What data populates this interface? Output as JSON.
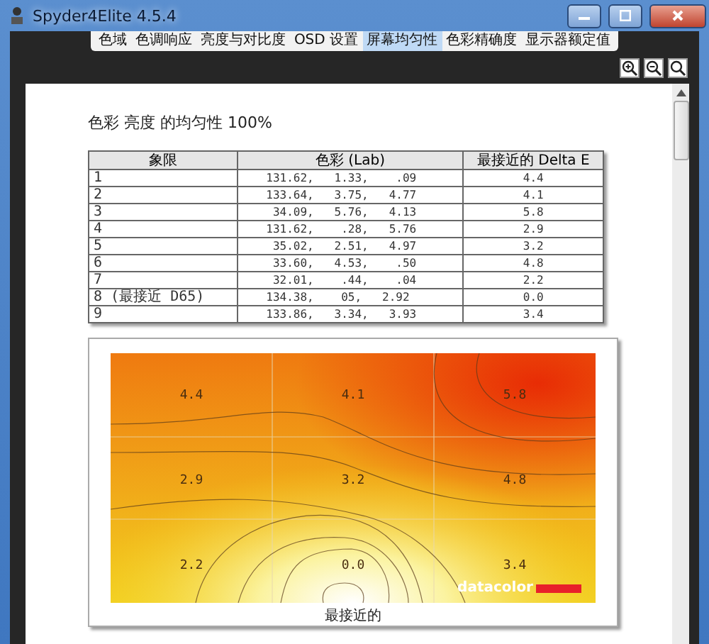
{
  "window": {
    "title": "Spyder4Elite 4.5.4"
  },
  "tabs": [
    {
      "label": "色域",
      "selected": false
    },
    {
      "label": "色调响应",
      "selected": false
    },
    {
      "label": "亮度与对比度",
      "selected": false
    },
    {
      "label": "OSD 设置",
      "selected": false
    },
    {
      "label": "屏幕均匀性",
      "selected": true
    },
    {
      "label": "色彩精确度",
      "selected": false
    },
    {
      "label": "显示器额定值",
      "selected": false
    }
  ],
  "report": {
    "title": "色彩 亮度 的均匀性 100%",
    "table": {
      "columns": [
        "象限",
        "色彩 (Lab)",
        "最接近的 Delta E"
      ],
      "rows": [
        {
          "quadrant": "1",
          "lab": "131.62,   1.33,    .09",
          "delta_e": "4.4"
        },
        {
          "quadrant": "2",
          "lab": "133.64,   3.75,   4.77",
          "delta_e": "4.1"
        },
        {
          "quadrant": "3",
          "lab": " 34.09,   5.76,   4.13",
          "delta_e": "5.8"
        },
        {
          "quadrant": "4",
          "lab": "131.62,    .28,   5.76",
          "delta_e": "2.9"
        },
        {
          "quadrant": "5",
          "lab": " 35.02,   2.51,   4.97",
          "delta_e": "3.2"
        },
        {
          "quadrant": "6",
          "lab": " 33.60,   4.53,    .50",
          "delta_e": "4.8"
        },
        {
          "quadrant": "7",
          "lab": " 32.01,    .44,    .04",
          "delta_e": "2.2"
        },
        {
          "quadrant": "8 (最接近 D65)",
          "lab": "134.38,    05,   2.92",
          "delta_e": "0.0"
        },
        {
          "quadrant": "9",
          "lab": "133.86,   3.34,   3.93",
          "delta_e": "3.4"
        }
      ]
    },
    "heatmap": {
      "cells": [
        "4.4",
        "4.1",
        "5.8",
        "2.9",
        "3.2",
        "4.8",
        "2.2",
        "0.0",
        "3.4"
      ],
      "logo": "datacolor",
      "caption": "最接近的"
    }
  }
}
